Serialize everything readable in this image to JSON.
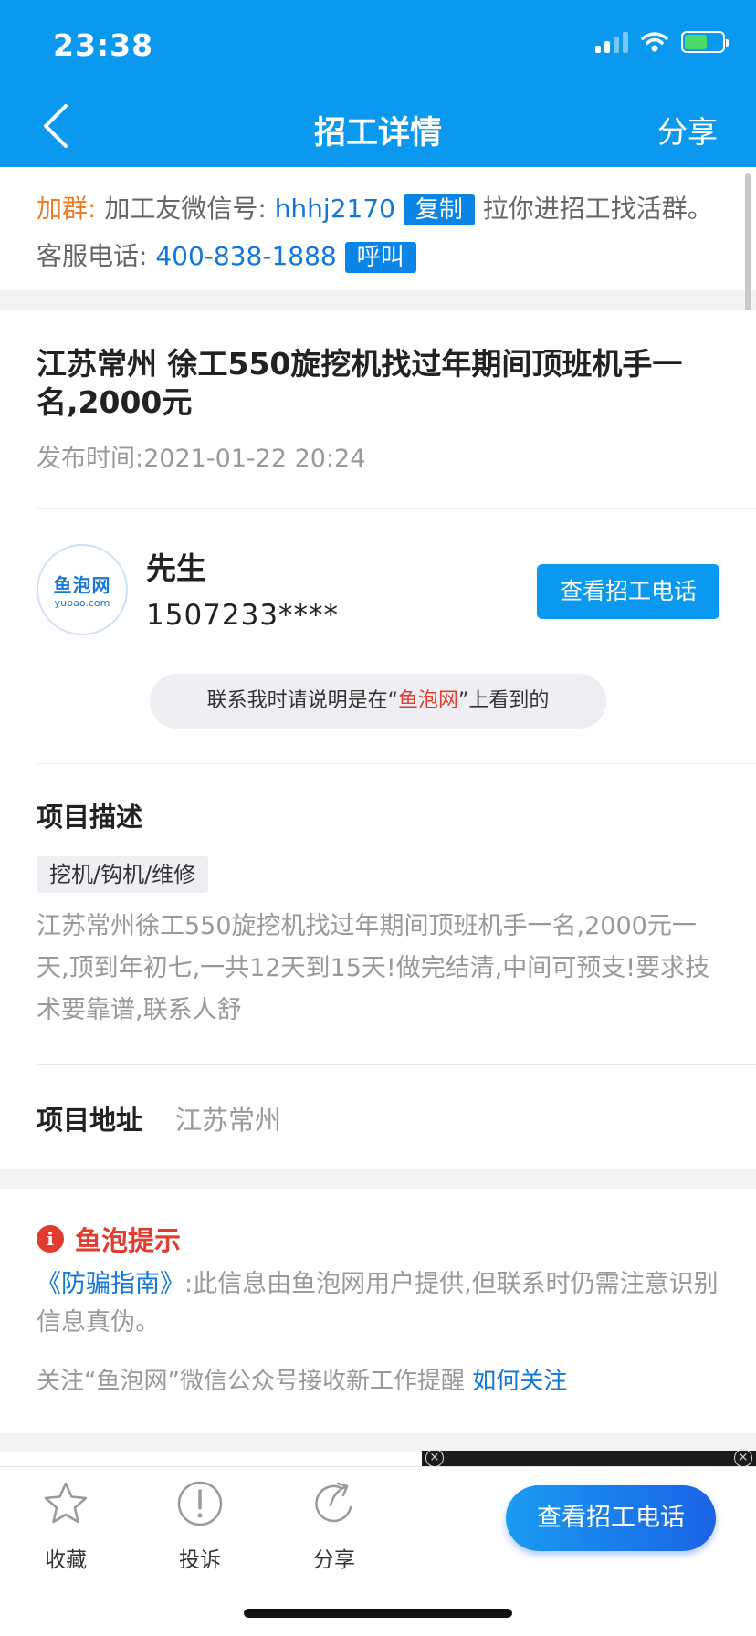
{
  "status_bar": {
    "time": "23:38"
  },
  "nav": {
    "title": "招工详情",
    "share": "分享"
  },
  "group_notice": {
    "label": "加群:",
    "text1": "加工友微信号:",
    "wechat": "hhhj2170",
    "copy_btn": "复制",
    "text2": "拉你进招工找活群。客服电话:",
    "phone": "400-838-1888",
    "call_btn": "呼叫"
  },
  "job": {
    "title": "江苏常州 徐工550旋挖机找过年期间顶班机手一名,2000元",
    "publish_label": "发布时间:",
    "publish_time": "2021-01-22 20:24",
    "contact_name": "先生",
    "contact_phone": "1507233****",
    "view_phone_btn": "查看招工电话",
    "avatar_logo": "鱼泡网",
    "avatar_url": "yupao.com",
    "notice_before": "联系我时请说明是在“",
    "notice_brand": "鱼泡网",
    "notice_after": "”上看到的",
    "desc_title": "项目描述",
    "category_tag": "挖机/钩机/维修",
    "description": "江苏常州徐工550旋挖机找过年期间顶班机手一名,2000元一天,顶到年初七,一共12天到15天!做完结清,中间可预支!要求技术要靠谱,联系人舒",
    "addr_title": "项目地址",
    "addr_value": "江苏常州"
  },
  "tips": {
    "title": "鱼泡提示",
    "guide_link": "《防骗指南》",
    "text": ":此信息由鱼泡网用户提供,但联系时仍需注意识别 信息真伪。",
    "follow_text": "关注“鱼泡网”微信公众号接收新工作提醒",
    "follow_link": "如何关注"
  },
  "bottom": {
    "collect": "收藏",
    "report": "投诉",
    "share": "分享",
    "cta": "查看招工电话"
  },
  "colors": {
    "primary": "#0a99ee",
    "accent_orange": "#f07c24",
    "warn_red": "#e23c30"
  }
}
